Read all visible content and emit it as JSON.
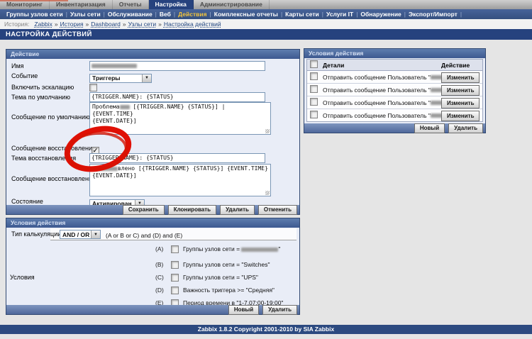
{
  "colors": {
    "accent_navy": "#26427e",
    "menu_blue": "#3d5990",
    "highlight_yellow": "#f2c43d",
    "annotation_red": "#e01005",
    "panel_bg": "#e9edf7"
  },
  "topmenu": {
    "tabs": [
      {
        "label": "Мониторинг",
        "active": false
      },
      {
        "label": "Инвентаризация",
        "active": false
      },
      {
        "label": "Отчеты",
        "active": false
      },
      {
        "label": "Настройка",
        "active": true
      },
      {
        "label": "Администрирование",
        "active": false
      }
    ]
  },
  "submenu": {
    "separator": "|",
    "items": [
      "Группы узлов сети",
      "Узлы сети",
      "Обслуживание",
      "Веб",
      "Действия",
      "Комплексные отчеты",
      "Карты сети",
      "Услуги IT",
      "Обнаружение",
      "Экспорт/Импорт"
    ],
    "highlighted": "Действия"
  },
  "breadcrumb": {
    "prefix": "История:",
    "separator": "»",
    "items": [
      "Zabbix",
      "История",
      "Dashboard",
      "Узлы сети",
      "Настройка действий"
    ]
  },
  "page_title": "НАСТРОЙКА ДЕЙСТВИЙ",
  "action_panel": {
    "title": "Действие",
    "name_label": "Имя",
    "event_label": "Событие",
    "event_value": "Триггеры",
    "escalation_label": "Включить эскалацию",
    "subject_label": "Тема по умолчанию",
    "subject_value": "{TRIGGER.NAME}: {STATUS}",
    "message_label": "Сообщение по умолчанию",
    "message_pre": "Проблема",
    "message_mid": " [{TRIGGER.NAME} {STATUS}] | {EVENT.TIME}",
    "message_line2": "{EVENT.DATE}]",
    "recovery_cb_label": "Сообщение восстановления",
    "check_glyph": "✓",
    "recovery_subject_label": "Тема восстановления",
    "recovery_subject_value": "{TRIGGER.NAME}: {STATUS}",
    "recovery_message_label": "Сообщение восстановления",
    "recovery_message_mid": "влено [{TRIGGER.NAME} {STATUS}] {EVENT.TIME}",
    "recovery_message_line2": "{EVENT.DATE}]",
    "status_label": "Состояние",
    "status_value": "Активирован",
    "buttons": {
      "save": "Сохранить",
      "clone": "Клонировать",
      "delete": "Удалить",
      "cancel": "Отменить"
    }
  },
  "conditions_panel": {
    "title": "Условия действия",
    "calc_label": "Тип калькуляции",
    "calc_value": "AND / OR",
    "calc_formula": "(A or B or C) and (D) and (E)",
    "group_label": "Условия",
    "items": [
      {
        "letter": "(A)",
        "pre": "Группы узлов сети = ",
        "post": "\""
      },
      {
        "letter": "(B)",
        "pre": "Группы узлов сети = \"Switches\"",
        "post": ""
      },
      {
        "letter": "(C)",
        "pre": "Группы узлов сети = \"UPS\"",
        "post": ""
      },
      {
        "letter": "(D)",
        "pre": "Важность триггера >= \"Средняя\"",
        "post": ""
      },
      {
        "letter": "(E)",
        "pre": "Период времени в \"1-7,07:00-19:00\"",
        "post": ""
      }
    ],
    "buttons": {
      "new": "Новый",
      "delete": "Удалить"
    }
  },
  "operations_panel": {
    "title": "Условия действия",
    "details_col": "Детали",
    "action_col": "Действие",
    "rows": [
      {
        "pre": "Отправить сообщение Пользователь \"",
        "post": "\"",
        "button": "Изменить"
      },
      {
        "pre": "Отправить сообщение Пользователь \"",
        "post": "\"",
        "button": "Изменить"
      },
      {
        "pre": "Отправить сообщение Пользователь \"",
        "post": "\"",
        "button": "Изменить"
      },
      {
        "pre": "Отправить сообщение Пользователь \"",
        "post": "\"",
        "button": "Изменить"
      }
    ],
    "buttons": {
      "new": "Новый",
      "delete": "Удалить"
    }
  },
  "footer": {
    "text": "Zabbix 1.8.2 Copyright 2001-2010 by SIA Zabbix"
  }
}
